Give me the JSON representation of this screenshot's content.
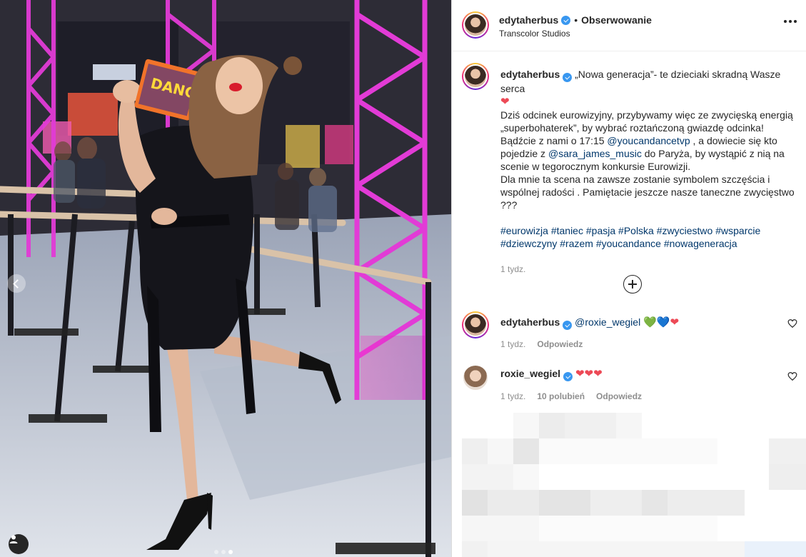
{
  "post": {
    "username": "edytaherbus",
    "bullet": "•",
    "follow_label": "Obserwowanie",
    "location": "Transcolor Studios",
    "caption_opening": "„Nowa generacja”- te dzieciaki skradną Wasze serca",
    "caption_heart": "❤",
    "caption_part1": "Dziś odcinek eurowizyjny, przybywamy więc ze zwycięską energią „superbohaterek”, by wybrać roztańczoną gwiazdę odcinka! Bądźcie z nami o 17:15 ",
    "mention_1": "@youcandancetvp",
    "caption_part2": " , a dowiecie się kto pojedzie z ",
    "mention_2": "@sara_james_music",
    "caption_part3": " do Paryża, by wystąpić z nią na scenie w tegorocznym konkursie Eurowizji.",
    "caption_part4": "Dla mnie ta scena na zawsze zostanie symbolem szczęścia i wspólnej radości . Pamiętacie jeszcze nasze taneczne zwycięstwo ???",
    "hashtags": [
      "#eurowizja",
      "#taniec",
      "#pasja",
      "#Polska",
      "#zwyciestwo",
      "#wsparcie",
      "#dziewczyny",
      "#razem",
      "#youcandance",
      "#nowageneracja"
    ],
    "time": "1 tydz."
  },
  "comments": [
    {
      "username": "edytaherbus",
      "mention": "@roxie_wegiel",
      "hearts": [
        "💚",
        "💙",
        "❤"
      ],
      "time": "1 tydz.",
      "reply_label": "Odpowiedz"
    },
    {
      "username": "roxie_wegiel",
      "hearts": [
        "❤",
        "❤",
        "❤"
      ],
      "time": "1 tydz.",
      "likes": "10 polubień",
      "reply_label": "Odpowiedz"
    }
  ],
  "media": {
    "carousel_index": 3,
    "carousel_total": 3
  },
  "colors": {
    "link": "#00376b",
    "verified": "#3897f0",
    "heart": "#ed4956",
    "neon_truss": "#e23bd6"
  }
}
